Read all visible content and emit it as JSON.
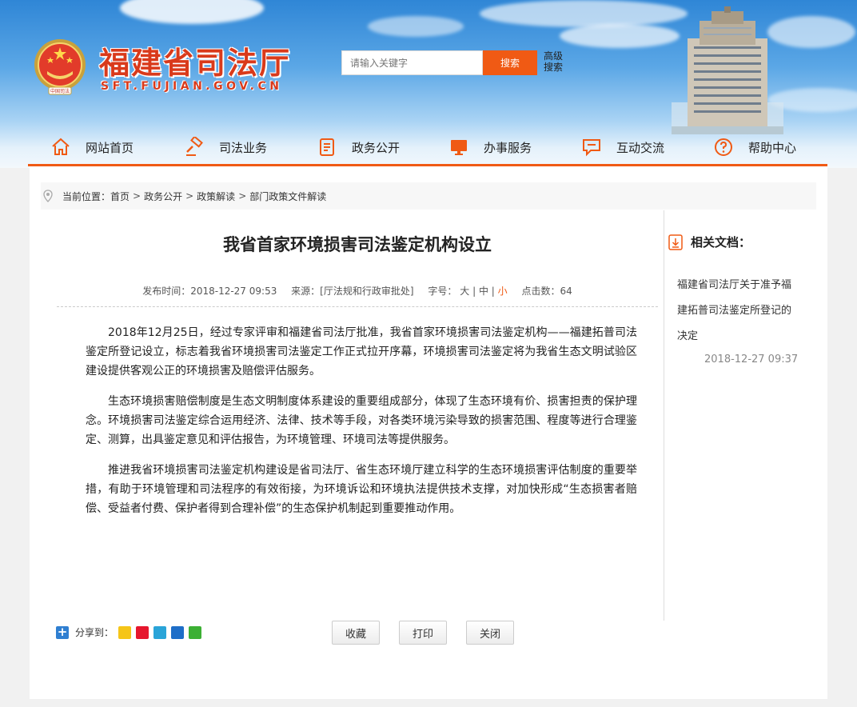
{
  "site": {
    "title": "福建省司法厅",
    "url": "SFT.FUJIAN.GOV.CN",
    "emblem_caption": "中国司法"
  },
  "search": {
    "placeholder": "请输入关键字",
    "button": "搜索",
    "advanced_line1": "高级",
    "advanced_line2": "搜索"
  },
  "nav": [
    {
      "label": "网站首页",
      "icon": "home-icon"
    },
    {
      "label": "司法业务",
      "icon": "gavel-icon"
    },
    {
      "label": "政务公开",
      "icon": "document-icon"
    },
    {
      "label": "办事服务",
      "icon": "monitor-icon"
    },
    {
      "label": "互动交流",
      "icon": "chat-icon"
    },
    {
      "label": "帮助中心",
      "icon": "help-icon"
    }
  ],
  "breadcrumb": {
    "prefix": "当前位置：",
    "items": [
      "首页",
      "政务公开",
      "政策解读",
      "部门政策文件解读"
    ],
    "separator": ">"
  },
  "article": {
    "title": "我省首家环境损害司法鉴定机构设立",
    "meta": {
      "published": "发布时间：2018-12-27 09:53",
      "source": "来源：[厅法规和行政审批处]",
      "font_label": "字号：",
      "size_large": "大",
      "size_medium": "中",
      "size_small": "小",
      "divider": "|",
      "clicks": "点击数：64"
    },
    "paragraphs": [
      "2018年12月25日，经过专家评审和福建省司法厅批准，我省首家环境损害司法鉴定机构——福建拓普司法鉴定所登记设立，标志着我省环境损害司法鉴定工作正式拉开序幕，环境损害司法鉴定将为我省生态文明试验区建设提供客观公正的环境损害及赔偿评估服务。",
      "生态环境损害赔偿制度是生态文明制度体系建设的重要组成部分，体现了生态环境有价、损害担责的保护理念。环境损害司法鉴定综合运用经济、法律、技术等手段，对各类环境污染导致的损害范围、程度等进行合理鉴定、测算，出具鉴定意见和评估报告，为环境管理、环境司法等提供服务。",
      "推进我省环境损害司法鉴定机构建设是省司法厅、省生态环境厅建立科学的生态环境损害评估制度的重要举措，有助于环境管理和司法程序的有效衔接，为环境诉讼和环境执法提供技术支撑，对加快形成“生态损害者赔偿、受益者付费、保护者得到合理补偿”的生态保护机制起到重要推动作用。"
    ]
  },
  "related": {
    "heading": "相关文档：",
    "link_text": "福建省司法厅关于准予福建拓普司法鉴定所登记的决定",
    "date": "2018-12-27 09:37"
  },
  "share": {
    "label": "分享到：",
    "icons": [
      "qzone-icon",
      "weibo-icon",
      "tencent-weibo-icon",
      "renren-icon",
      "wechat-icon"
    ]
  },
  "buttons": {
    "favorite": "收藏",
    "print": "打印",
    "close": "关闭"
  },
  "colors": {
    "accent": "#f05a14",
    "brand_red": "#d93a1b",
    "sky_top": "#2f86d6"
  }
}
